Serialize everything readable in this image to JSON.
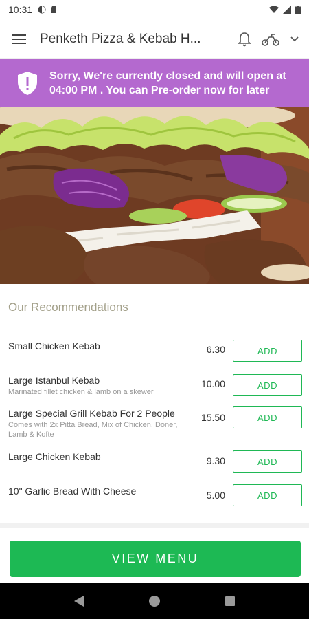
{
  "status_bar": {
    "time": "10:31",
    "icons": [
      "data-saver-icon",
      "sd-card-icon",
      "wifi-icon",
      "signal-icon",
      "battery-icon"
    ]
  },
  "app_bar": {
    "title": "Penketh Pizza & Kebab H...",
    "icons": [
      "hamburger-menu-icon",
      "bell-icon",
      "delivery-scooter-icon",
      "chevron-down-icon"
    ]
  },
  "banner": {
    "line1": "Sorry, We're currently closed and will open at",
    "line2": "04:00 PM . You can Pre-order now for later",
    "color": "#b469cf"
  },
  "recommendations": {
    "title": "Our Recommendations",
    "items": [
      {
        "name": "Small Chicken Kebab",
        "desc": "",
        "price": "6.30",
        "button": "ADD"
      },
      {
        "name": "Large Istanbul Kebab",
        "desc": "Marinated fillet chicken & lamb on a skewer",
        "price": "10.00",
        "button": "ADD"
      },
      {
        "name": "Large Special Grill Kebab For 2 People",
        "desc": "Comes with 2x Pitta Bread, Mix of Chicken, Doner, Lamb & Kofte",
        "price": "15.50",
        "button": "ADD"
      },
      {
        "name": "Large Chicken Kebab",
        "desc": "",
        "price": "9.30",
        "button": "ADD"
      },
      {
        "name": "10\" Garlic Bread With Cheese",
        "desc": "",
        "price": "5.00",
        "button": "ADD"
      }
    ]
  },
  "view_menu_label": "VIEW MENU",
  "colors": {
    "accent_green": "#1db954",
    "banner_purple": "#b469cf",
    "section_title": "#a3a08a"
  }
}
